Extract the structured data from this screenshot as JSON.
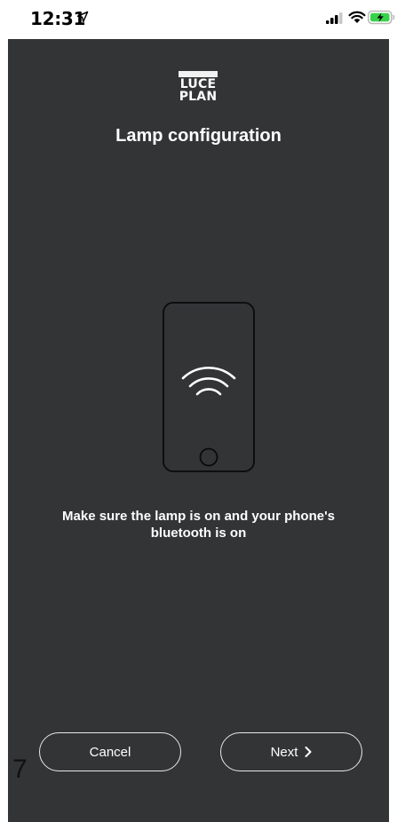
{
  "status_bar": {
    "time": "12:31",
    "icons": [
      "location-arrow-icon",
      "cellular-signal-icon",
      "wifi-icon",
      "battery-charging-icon"
    ]
  },
  "app": {
    "logo_lines": [
      "LUCE",
      "PLAN"
    ],
    "title": "Lamp configuration",
    "illustration": "phone-bluetooth-icon",
    "instruction": "Make sure the lamp is on and your phone's bluetooth is on"
  },
  "footer": {
    "cancel_label": "Cancel",
    "next_label": "Next",
    "page_number": "7"
  },
  "colors": {
    "background": "#323436",
    "text": "#ffffff",
    "battery_green": "#37d24a"
  }
}
